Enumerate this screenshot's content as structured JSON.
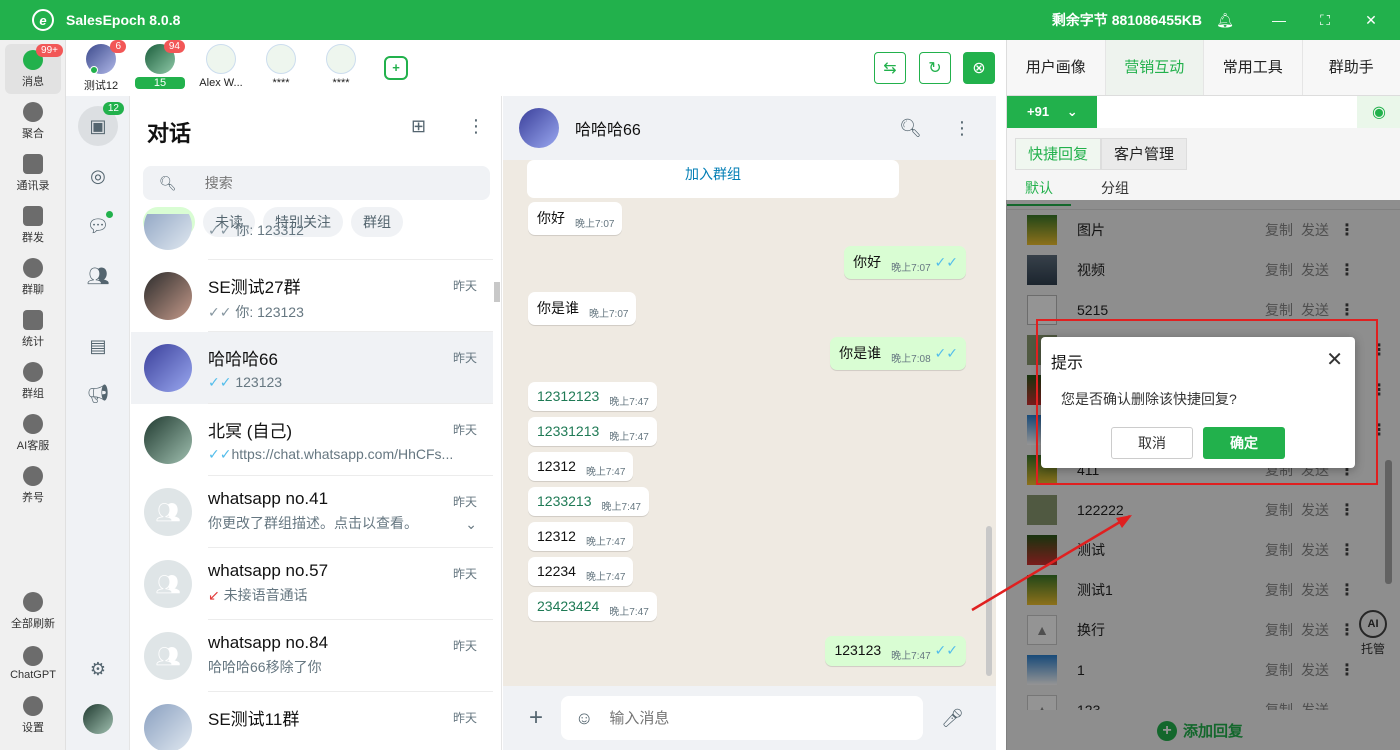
{
  "app": {
    "title": "SalesEpoch 8.0.8",
    "logo_letter": "e",
    "remaining_bytes": "剩余字节 881086455KB"
  },
  "leftnav": [
    {
      "label": "消息",
      "badge": "99+"
    },
    {
      "label": "聚合"
    },
    {
      "label": "通讯录"
    },
    {
      "label": "群发"
    },
    {
      "label": "群聊"
    },
    {
      "label": "统计"
    },
    {
      "label": "群组"
    },
    {
      "label": "AI客服"
    },
    {
      "label": "养号"
    },
    {
      "label": "全部刷新"
    },
    {
      "label": "ChatGPT"
    },
    {
      "label": "设置"
    }
  ],
  "accounts": [
    {
      "name": "测试12",
      "badge": "6"
    },
    {
      "name": "15",
      "badge": "94"
    },
    {
      "name": "Alex W..."
    },
    {
      "name": "****"
    },
    {
      "name": "****"
    }
  ],
  "wa_rail": {
    "chats_badge": "12"
  },
  "chatlist": {
    "title": "对话",
    "search_placeholder": "搜索",
    "filters": [
      "所有",
      "未读",
      "特别关注",
      "群组"
    ],
    "chats": [
      {
        "name": "",
        "msg": "你: 123312",
        "time": "",
        "tick": "✓✓"
      },
      {
        "name": "SE测试27群",
        "msg": "你: 123123",
        "time": "昨天",
        "tick": "✓✓"
      },
      {
        "name": "哈哈哈66",
        "msg": "123123",
        "time": "昨天",
        "tick": "✓✓"
      },
      {
        "name": "北冥 (自己)",
        "msg": "https://chat.whatsapp.com/HhCFs...",
        "time": "昨天",
        "tick": "✓✓"
      },
      {
        "name": "whatsapp no.41",
        "msg": "你更改了群组描述。点击以查看。",
        "time": "昨天"
      },
      {
        "name": "whatsapp no.57",
        "msg": "未接语音通话",
        "time": "昨天"
      },
      {
        "name": "whatsapp no.84",
        "msg": "哈哈哈66移除了你",
        "time": "昨天"
      },
      {
        "name": "SE测试11群",
        "msg": "",
        "time": "昨天"
      }
    ]
  },
  "conversation": {
    "contact": "哈哈哈66",
    "join_group": "加入群组",
    "input_placeholder": "输入消息",
    "messages": [
      {
        "dir": "in",
        "text": "你好",
        "time": "晚上7:07"
      },
      {
        "dir": "out",
        "text": "你好",
        "time": "晚上7:07"
      },
      {
        "dir": "in",
        "text": "你是谁",
        "time": "晚上7:07"
      },
      {
        "dir": "out",
        "text": "你是谁",
        "time": "晚上7:08"
      },
      {
        "dir": "in",
        "text": "12312123",
        "time": "晚上7:47"
      },
      {
        "dir": "in",
        "text": "12331213",
        "time": "晚上7:47"
      },
      {
        "dir": "in",
        "text": "12312",
        "time": "晚上7:47"
      },
      {
        "dir": "in",
        "text": "1233213",
        "time": "晚上7:47"
      },
      {
        "dir": "in",
        "text": "12312",
        "time": "晚上7:47"
      },
      {
        "dir": "in",
        "text": "12234",
        "time": "晚上7:47"
      },
      {
        "dir": "in",
        "text": "23423424",
        "time": "晚上7:47"
      },
      {
        "dir": "out",
        "text": "123123",
        "time": "晚上7:47"
      }
    ]
  },
  "rpanel": {
    "tabs": [
      "用户画像",
      "营销互动",
      "常用工具",
      "群助手"
    ],
    "country_code": "+91",
    "subtabs": [
      "快捷回复",
      "客户管理"
    ],
    "group_tabs": [
      "默认",
      "分组"
    ],
    "copy_label": "复制",
    "send_label": "发送",
    "items": [
      "图片",
      "视频",
      "5215",
      "",
      "",
      "",
      "411",
      "122222",
      "测试",
      "测试1",
      "换行",
      "1",
      "123"
    ],
    "add_label": "添加回复",
    "ai_host_label": "托管",
    "ai_host_badge": "AI"
  },
  "dialog": {
    "title": "提示",
    "message": "您是否确认删除该快捷回复?",
    "cancel": "取消",
    "ok": "确定"
  },
  "colors": {
    "brand": "#22b14c",
    "annotation": "#e02020"
  }
}
